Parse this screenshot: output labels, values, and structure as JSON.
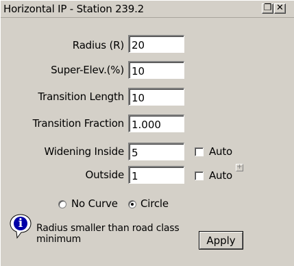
{
  "window": {
    "title": "Horizontal IP - Station 239.2",
    "restore_glyph": "❐",
    "close_glyph": "✕"
  },
  "form": {
    "radius": {
      "label": "Radius (R)",
      "value": "20"
    },
    "super_elev": {
      "label": "Super-Elev.(%)",
      "value": "10"
    },
    "transition_length": {
      "label": "Transition Length",
      "value": "10"
    },
    "transition_fraction": {
      "label": "Transition Fraction",
      "value": "1.000"
    },
    "widening_inside": {
      "label": "Widening Inside",
      "value": "5",
      "auto_label": "Auto",
      "auto_checked": false
    },
    "outside": {
      "label": "Outside",
      "value": "1",
      "auto_label": "Auto",
      "auto_checked": false
    },
    "plus_glyph": "+"
  },
  "curve_type": {
    "options": [
      {
        "label": "No Curve",
        "selected": false
      },
      {
        "label": "Circle",
        "selected": true
      }
    ]
  },
  "message": {
    "icon": "info-icon",
    "icon_glyph": "i",
    "text_line1": "Radius smaller than road class",
    "text_line2": "minimum"
  },
  "apply_label": "Apply"
}
